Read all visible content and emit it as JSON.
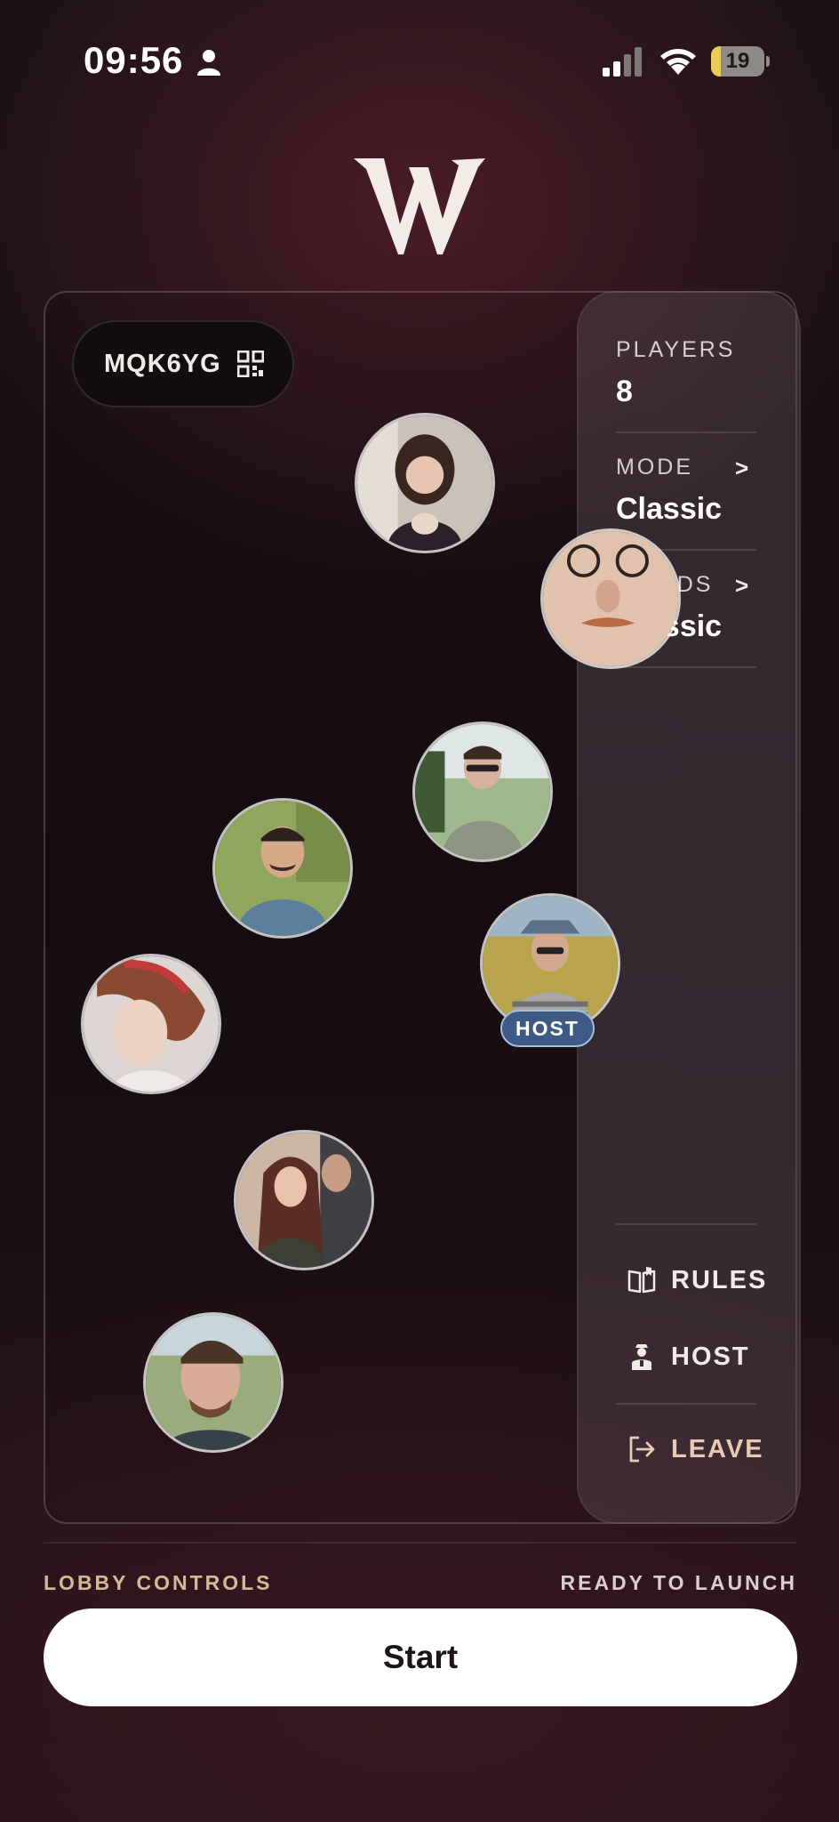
{
  "status_bar": {
    "time": "09:56",
    "battery_level": "19",
    "battery_fraction": 0.19
  },
  "logo": {
    "letter": "W"
  },
  "lobby": {
    "room_code": "MQK6YG",
    "players_label": "PLAYERS",
    "players_count": "8",
    "mode_label": "MODE",
    "mode_value": "Classic",
    "wurds_label": "WURDS",
    "wurds_value": "Classic",
    "chevron": ">",
    "actions": [
      {
        "label": "RULES",
        "icon": "book-icon"
      },
      {
        "label": "HOST",
        "icon": "host-person-icon"
      },
      {
        "label": "LEAVE",
        "icon": "leave-icon"
      }
    ],
    "host_badge": "HOST"
  },
  "colors": {
    "accent_gold": "#d8b89a",
    "host_badge": "#3e5b88",
    "battery_low": "#e8cc58"
  },
  "footer": {
    "controls_label": "LOBBY CONTROLS",
    "status_label": "READY TO LAUNCH",
    "start_label": "Start"
  }
}
